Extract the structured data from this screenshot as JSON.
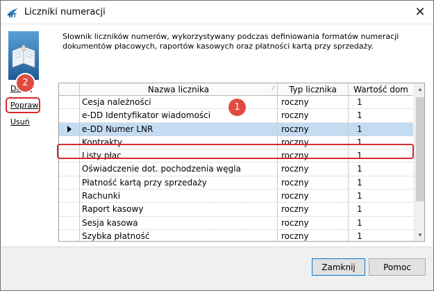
{
  "window": {
    "title": "Liczniki numeracji",
    "close_glyph": "✕"
  },
  "description": "Słownik liczników numerów, wykorzystywany podczas definiowania formatów numeracji dokumentów płacowych, raportów kasowych oraz płatności kartą przy sprzedaży.",
  "actions": {
    "add": "Dodaj",
    "edit": "Popraw",
    "delete": "Usuń"
  },
  "annotations": {
    "badge_1": "1",
    "badge_2": "2"
  },
  "grid": {
    "columns": [
      "Nazwa licznika",
      "Typ licznika",
      "Wartość dom"
    ],
    "sort_glyph": "⁄",
    "selected_index": 2,
    "rows": [
      {
        "name": "Cesja należności",
        "type": "roczny",
        "value": "1"
      },
      {
        "name": "e-DD Identyfikator wiadomości",
        "type": "roczny",
        "value": "1"
      },
      {
        "name": "e-DD Numer LNR",
        "type": "roczny",
        "value": "1"
      },
      {
        "name": "Kontrakty",
        "type": "roczny",
        "value": "1"
      },
      {
        "name": "Listy płac",
        "type": "roczny",
        "value": "1"
      },
      {
        "name": "Oświadczenie dot. pochodzenia węgla",
        "type": "roczny",
        "value": "1"
      },
      {
        "name": "Płatność kartą przy sprzedaży",
        "type": "roczny",
        "value": "1"
      },
      {
        "name": "Rachunki",
        "type": "roczny",
        "value": "1"
      },
      {
        "name": "Raport kasowy",
        "type": "roczny",
        "value": "1"
      },
      {
        "name": "Sesja kasowa",
        "type": "roczny",
        "value": "1"
      },
      {
        "name": "Szybka płatność",
        "type": "roczny",
        "value": "1"
      }
    ]
  },
  "footer": {
    "close_label": "Zamknij",
    "help_label": "Pomoc"
  },
  "icons": {
    "app": "gt-logo-icon",
    "dictionary": "book-icon",
    "row_pointer": "row-pointer-icon"
  },
  "colors": {
    "selection": "#c4dcf2",
    "annotation": "#d9262f",
    "badge": "#e04b3f"
  }
}
